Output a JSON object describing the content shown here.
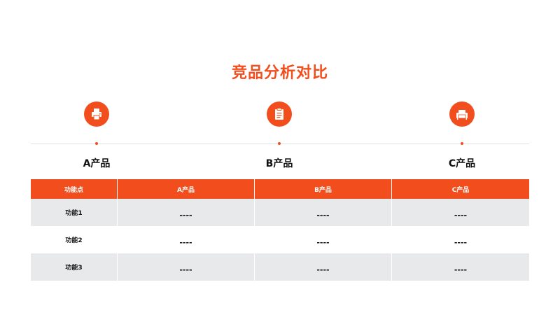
{
  "title": "竞品分析对比",
  "products": [
    {
      "name": "A产品",
      "icon": "printer-icon"
    },
    {
      "name": "B产品",
      "icon": "clipboard-icon"
    },
    {
      "name": "C产品",
      "icon": "sofa-icon"
    }
  ],
  "table": {
    "headers": [
      "功能点",
      "A产品",
      "B产品",
      "C产品"
    ],
    "rows": [
      {
        "feature": "功能1",
        "values": [
          "----",
          "----",
          "----"
        ]
      },
      {
        "feature": "功能2",
        "values": [
          "----",
          "----",
          "----"
        ]
      },
      {
        "feature": "功能3",
        "values": [
          "----",
          "----",
          "----"
        ]
      }
    ]
  },
  "colors": {
    "accent": "#f24d1c",
    "row_shade": "#e8e9eb",
    "divider": "#e2e2e2"
  }
}
